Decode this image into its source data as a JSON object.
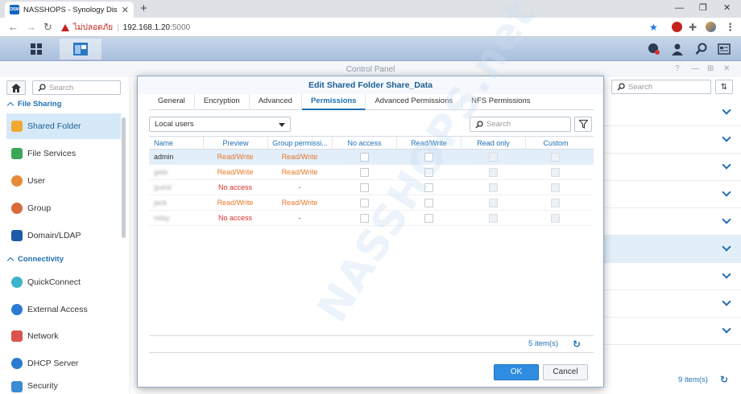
{
  "browser": {
    "tab_title": "NASSHOPS - Synology DiskStation",
    "favicon_text": "DSM",
    "insecure_label": "ไม่ปลอดภัย",
    "url_host": "192.168.1.20",
    "url_port": ":5000"
  },
  "window": {
    "title": "Control Panel"
  },
  "sidebar": {
    "search_placeholder": "Search",
    "groups": [
      {
        "label": "File Sharing"
      },
      {
        "label": "Connectivity"
      }
    ],
    "items": [
      {
        "label": "Shared Folder",
        "color": "#f0a830"
      },
      {
        "label": "File Services",
        "color": "#3aa757"
      },
      {
        "label": "User",
        "color": "#e58a3a"
      },
      {
        "label": "Group",
        "color": "#d96b3a"
      },
      {
        "label": "Domain/LDAP",
        "color": "#1f5aa8"
      },
      {
        "label": "QuickConnect",
        "color": "#3bb3c9"
      },
      {
        "label": "External Access",
        "color": "#2a7bd1"
      },
      {
        "label": "Network",
        "color": "#d9534f"
      },
      {
        "label": "DHCP Server",
        "color": "#2a7bd1"
      },
      {
        "label": "Security",
        "color": "#3a8bd1"
      }
    ]
  },
  "main": {
    "search_placeholder": "Search",
    "count": "9 item(s)"
  },
  "dialog": {
    "title": "Edit Shared Folder Share_Data",
    "tabs": [
      "General",
      "Encryption",
      "Advanced",
      "Permissions",
      "Advanced Permissions",
      "NFS Permissions"
    ],
    "active_tab": "Permissions",
    "user_filter": "Local users",
    "search_placeholder": "Search",
    "columns": [
      "Name",
      "Preview",
      "Group permissi...",
      "No access",
      "Read/Write",
      "Read only",
      "Custom"
    ],
    "rows": [
      {
        "name": "admin",
        "preview": "Read/Write",
        "group": "Read/Write"
      },
      {
        "name": "gate",
        "preview": "Read/Write",
        "group": "Read/Write"
      },
      {
        "name": "guest",
        "preview": "No access",
        "group": "-"
      },
      {
        "name": "jack",
        "preview": "Read/Write",
        "group": "Read/Write"
      },
      {
        "name": "relay",
        "preview": "No access",
        "group": "-"
      }
    ],
    "count": "5 item(s)",
    "ok_label": "OK",
    "cancel_label": "Cancel"
  },
  "watermark": "NASSHOPS.net",
  "colors": {
    "accent": "#1f6fb4",
    "primary_button": "#2e8de0",
    "permission_text": "#e8782a",
    "selected_row": "#e2eef9"
  }
}
